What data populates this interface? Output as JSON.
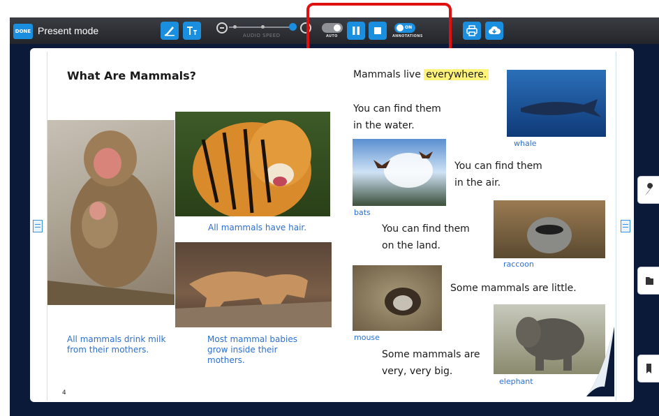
{
  "toolbar": {
    "done_label": "DONE",
    "mode_title": "Present mode",
    "audio_speed_label": "AUDIO SPEED",
    "auto_label": "AUTO",
    "annotations_label": "ANNOTATIONS",
    "annotations_toggle_text": "ON"
  },
  "page": {
    "heading": "What Are Mammals?",
    "page_number": "4",
    "captions": {
      "hair": "All mammals have hair.",
      "milk": "All mammals drink milk from their mothers.",
      "babies": "Most mammal babies grow inside their mothers."
    },
    "photo_labels": {
      "whale": "whale",
      "bats": "bats",
      "raccoon": "raccoon",
      "mouse": "mouse",
      "elephant": "elephant"
    },
    "text": {
      "live_before": "Mammals live",
      "live_highlight": "everywhere.",
      "water_1": "You can find them",
      "water_2": "in the water.",
      "air_1": "You can find them",
      "air_2": "in the air.",
      "land_1": "You can find them",
      "land_2": "on the land.",
      "little": "Some mammals are little.",
      "big_1": "Some mammals are",
      "big_2": "very, very big."
    }
  },
  "colors": {
    "accent": "#1a8fe0",
    "caption": "#2c6fd0",
    "highlight": "#fff37a",
    "callout": "#e01010"
  }
}
